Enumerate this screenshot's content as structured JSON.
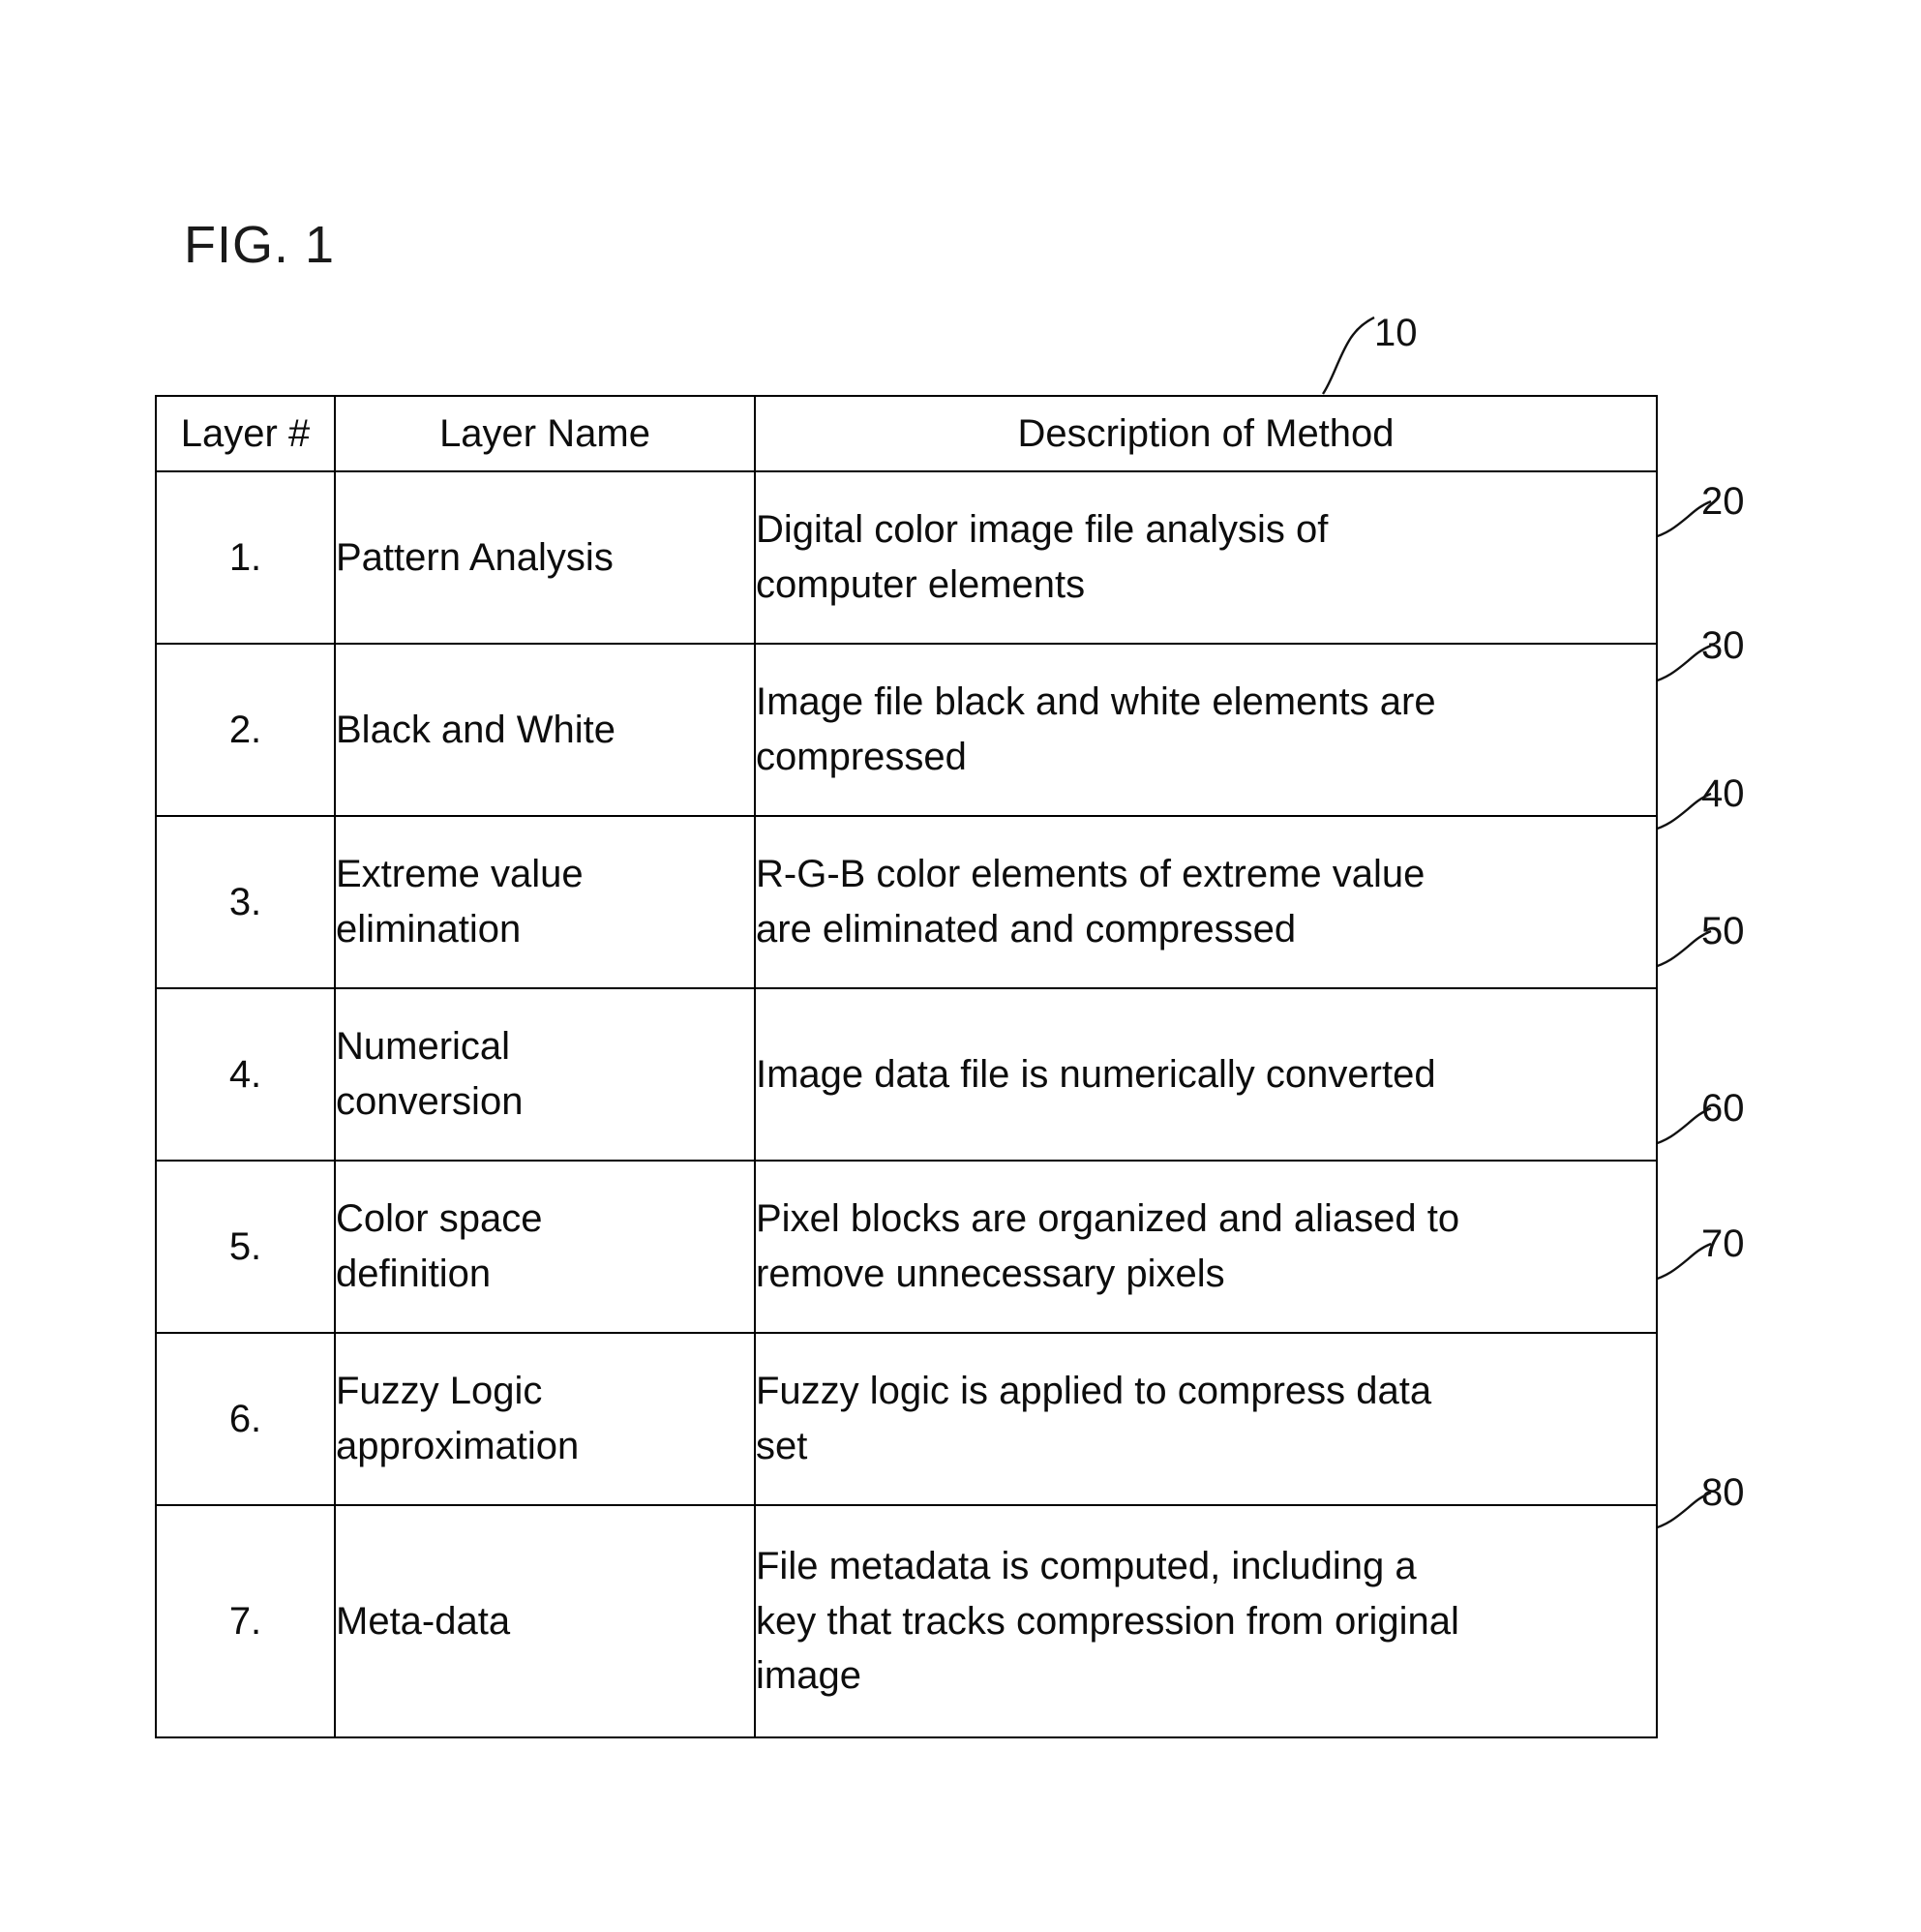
{
  "figure": {
    "label": "FIG. 1",
    "table_callout": "10"
  },
  "table": {
    "columns": [
      "Layer #",
      "Layer Name",
      "Description of Method"
    ],
    "rows": [
      {
        "num": "1.",
        "name": [
          "Pattern Analysis"
        ],
        "desc": [
          "Digital color image file analysis of",
          "computer elements"
        ],
        "callout": "20"
      },
      {
        "num": "2.",
        "name": [
          "Black and White"
        ],
        "desc": [
          "Image file black and white elements are",
          "compressed"
        ],
        "callout": "30"
      },
      {
        "num": "3.",
        "name": [
          "Extreme value",
          "elimination"
        ],
        "desc": [
          "R-G-B color elements of extreme value",
          "are eliminated and compressed"
        ],
        "callout": "40"
      },
      {
        "num": "4.",
        "name": [
          "Numerical",
          "conversion"
        ],
        "desc": [
          "Image data file is numerically converted"
        ],
        "callout": "50"
      },
      {
        "num": "5.",
        "name": [
          "Color space",
          "definition"
        ],
        "desc": [
          "Pixel blocks are organized and aliased to",
          "remove unnecessary pixels"
        ],
        "callout": "60"
      },
      {
        "num": "6.",
        "name": [
          "Fuzzy Logic",
          "approximation"
        ],
        "desc": [
          "Fuzzy logic is applied to compress data",
          "set"
        ],
        "callout": "70"
      },
      {
        "num": "7.",
        "name": [
          "Meta-data"
        ],
        "desc": [
          "File metadata is computed, including a",
          "key that tracks compression from original",
          "image"
        ],
        "callout": "80"
      }
    ]
  },
  "colors": {
    "ink": "#111111",
    "paper": "#ffffff"
  }
}
